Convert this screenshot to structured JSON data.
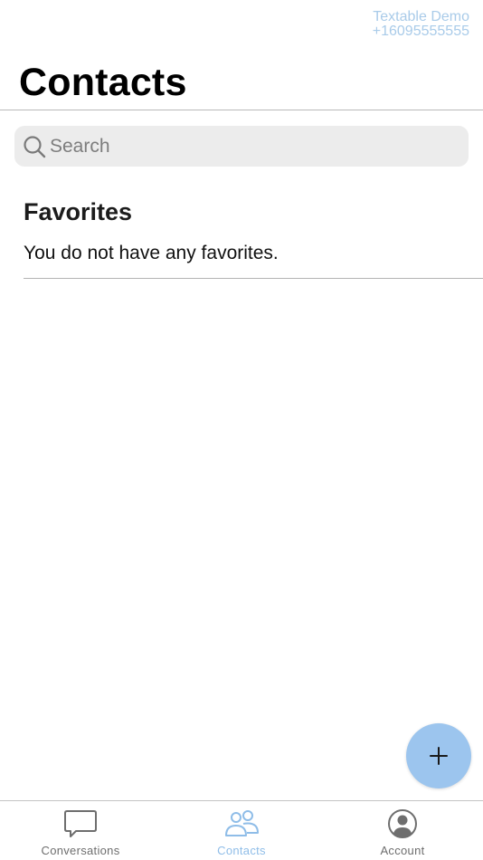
{
  "account": {
    "name": "Textable Demo",
    "phone": "+16095555555",
    "accent_color": "#a9cbe9"
  },
  "header": {
    "title": "Contacts"
  },
  "search": {
    "placeholder": "Search",
    "value": "",
    "icon": "search-icon"
  },
  "favorites": {
    "title": "Favorites",
    "empty_message": "You do not have any favorites."
  },
  "fab": {
    "icon": "plus-icon",
    "color": "#9cc5ee"
  },
  "tabbar": {
    "active_color": "#8fbde8",
    "inactive_color": "#6e6e6e",
    "tabs": [
      {
        "label": "Conversations",
        "icon": "chat-bubble-icon",
        "active": false
      },
      {
        "label": "Contacts",
        "icon": "people-icon",
        "active": true
      },
      {
        "label": "Account",
        "icon": "user-circle-icon",
        "active": false
      }
    ]
  }
}
